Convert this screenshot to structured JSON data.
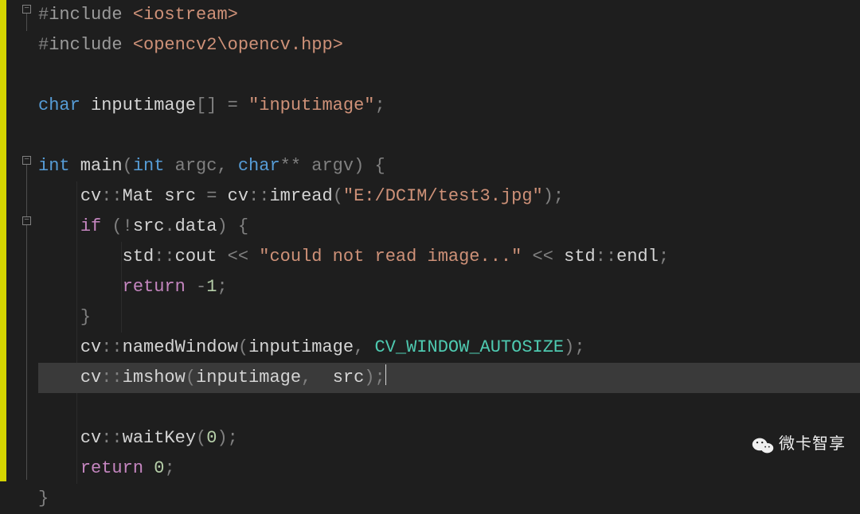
{
  "code": {
    "lines": [
      {
        "indent": 0,
        "tokens": [
          {
            "cls": "punct",
            "t": "#"
          },
          {
            "cls": "kw-preproc",
            "t": "include "
          },
          {
            "cls": "string",
            "t": "<iostream>"
          }
        ],
        "fold": "start"
      },
      {
        "indent": 0,
        "tokens": [
          {
            "cls": "punct",
            "t": "#"
          },
          {
            "cls": "kw-preproc",
            "t": "include "
          },
          {
            "cls": "string",
            "t": "<opencv2\\opencv.hpp>"
          }
        ]
      },
      {
        "indent": 0,
        "tokens": []
      },
      {
        "indent": 0,
        "tokens": [
          {
            "cls": "kw-type",
            "t": "char"
          },
          {
            "cls": "identifier",
            "t": " inputimage"
          },
          {
            "cls": "punct",
            "t": "[] = "
          },
          {
            "cls": "string",
            "t": "\"inputimage\""
          },
          {
            "cls": "punct",
            "t": ";"
          }
        ]
      },
      {
        "indent": 0,
        "tokens": []
      },
      {
        "indent": 0,
        "tokens": [
          {
            "cls": "kw-type",
            "t": "int"
          },
          {
            "cls": "func",
            "t": " main"
          },
          {
            "cls": "punct",
            "t": "("
          },
          {
            "cls": "kw-type",
            "t": "int"
          },
          {
            "cls": "param",
            "t": " argc"
          },
          {
            "cls": "punct",
            "t": ", "
          },
          {
            "cls": "kw-type",
            "t": "char"
          },
          {
            "cls": "punct",
            "t": "** "
          },
          {
            "cls": "param",
            "t": "argv"
          },
          {
            "cls": "punct",
            "t": ") {"
          }
        ],
        "fold": "start"
      },
      {
        "indent": 1,
        "tokens": [
          {
            "cls": "identifier",
            "t": "cv"
          },
          {
            "cls": "punct",
            "t": "::"
          },
          {
            "cls": "identifier",
            "t": "Mat src "
          },
          {
            "cls": "punct",
            "t": "= "
          },
          {
            "cls": "identifier",
            "t": "cv"
          },
          {
            "cls": "punct",
            "t": "::"
          },
          {
            "cls": "func",
            "t": "imread"
          },
          {
            "cls": "punct",
            "t": "("
          },
          {
            "cls": "string",
            "t": "\"E:/DCIM/test3.jpg\""
          },
          {
            "cls": "punct",
            "t": ");"
          }
        ]
      },
      {
        "indent": 1,
        "tokens": [
          {
            "cls": "kw-control",
            "t": "if"
          },
          {
            "cls": "punct",
            "t": " (!"
          },
          {
            "cls": "identifier",
            "t": "src"
          },
          {
            "cls": "punct",
            "t": "."
          },
          {
            "cls": "member",
            "t": "data"
          },
          {
            "cls": "punct",
            "t": ") {"
          }
        ],
        "fold": "start"
      },
      {
        "indent": 2,
        "tokens": [
          {
            "cls": "identifier",
            "t": "std"
          },
          {
            "cls": "punct",
            "t": "::"
          },
          {
            "cls": "identifier",
            "t": "cout "
          },
          {
            "cls": "punct",
            "t": "<< "
          },
          {
            "cls": "string",
            "t": "\"could not read image...\""
          },
          {
            "cls": "punct",
            "t": " << "
          },
          {
            "cls": "identifier",
            "t": "std"
          },
          {
            "cls": "punct",
            "t": "::"
          },
          {
            "cls": "identifier",
            "t": "endl"
          },
          {
            "cls": "punct",
            "t": ";"
          }
        ]
      },
      {
        "indent": 2,
        "tokens": [
          {
            "cls": "kw-return",
            "t": "return"
          },
          {
            "cls": "punct",
            "t": " -"
          },
          {
            "cls": "number",
            "t": "1"
          },
          {
            "cls": "punct",
            "t": ";"
          }
        ]
      },
      {
        "indent": 1,
        "tokens": [
          {
            "cls": "punct",
            "t": "}"
          }
        ]
      },
      {
        "indent": 1,
        "tokens": [
          {
            "cls": "identifier",
            "t": "cv"
          },
          {
            "cls": "punct",
            "t": "::"
          },
          {
            "cls": "func",
            "t": "namedWindow"
          },
          {
            "cls": "punct",
            "t": "("
          },
          {
            "cls": "identifier",
            "t": "inputimage"
          },
          {
            "cls": "punct",
            "t": ", "
          },
          {
            "cls": "macro",
            "t": "CV_WINDOW_AUTOSIZE"
          },
          {
            "cls": "punct",
            "t": ");"
          }
        ]
      },
      {
        "indent": 1,
        "tokens": [
          {
            "cls": "identifier",
            "t": "cv"
          },
          {
            "cls": "punct",
            "t": "::"
          },
          {
            "cls": "func",
            "t": "imshow"
          },
          {
            "cls": "punct",
            "t": "("
          },
          {
            "cls": "identifier",
            "t": "inputimage"
          },
          {
            "cls": "punct",
            "t": ",  "
          },
          {
            "cls": "identifier",
            "t": "src"
          },
          {
            "cls": "punct",
            "t": ");"
          }
        ],
        "current": true
      },
      {
        "indent": 0,
        "tokens": []
      },
      {
        "indent": 1,
        "tokens": [
          {
            "cls": "identifier",
            "t": "cv"
          },
          {
            "cls": "punct",
            "t": "::"
          },
          {
            "cls": "func",
            "t": "waitKey"
          },
          {
            "cls": "punct",
            "t": "("
          },
          {
            "cls": "number",
            "t": "0"
          },
          {
            "cls": "punct",
            "t": ");"
          }
        ]
      },
      {
        "indent": 1,
        "tokens": [
          {
            "cls": "kw-return",
            "t": "return"
          },
          {
            "cls": "punct",
            "t": " "
          },
          {
            "cls": "number",
            "t": "0"
          },
          {
            "cls": "punct",
            "t": ";"
          }
        ]
      },
      {
        "indent": 0,
        "tokens": [
          {
            "cls": "punct",
            "t": "}"
          }
        ]
      }
    ]
  },
  "watermark": {
    "text": "微卡智享"
  }
}
